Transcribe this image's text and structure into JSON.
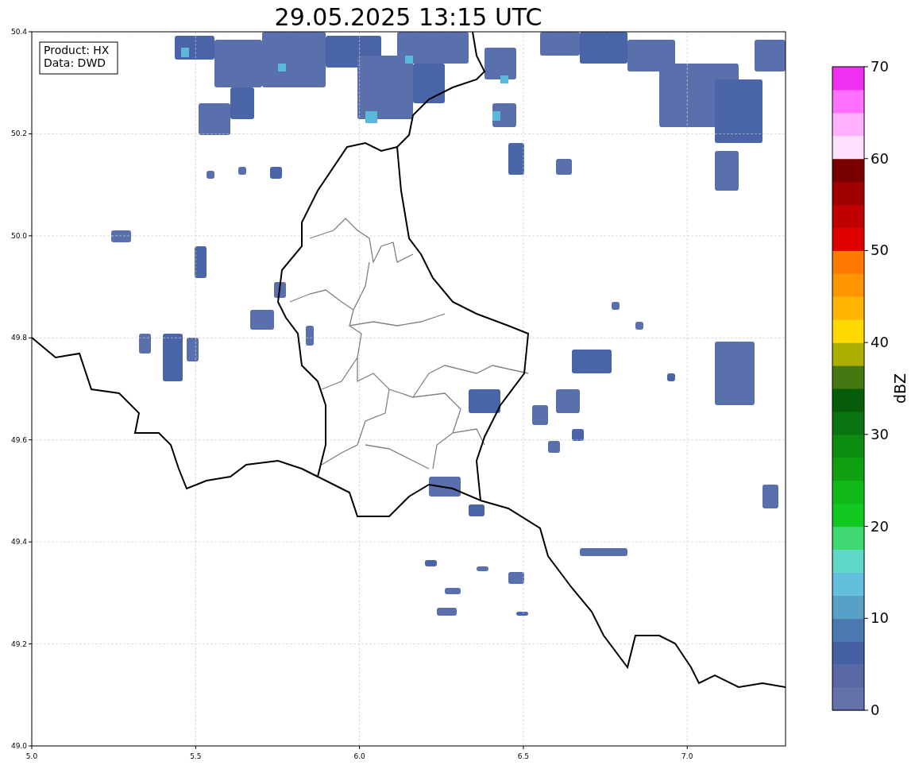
{
  "title": "29.05.2025 13:15 UTC",
  "info_box": [
    "Product: HX",
    "Data: DWD"
  ],
  "map": {
    "xticks": [
      "5.0",
      "5.5",
      "6.0",
      "6.5",
      "7.0"
    ],
    "yticks": [
      "50.4",
      "50.2",
      "50.0",
      "49.8",
      "49.6",
      "49.4",
      "49.2",
      "49.0"
    ]
  },
  "colorbar": {
    "label": "dBZ",
    "ticks": [
      "70",
      "60",
      "50",
      "40",
      "30",
      "20",
      "10",
      "0"
    ],
    "bins": [
      {
        "color": "#6272a8"
      },
      {
        "color": "#5868a4"
      },
      {
        "color": "#4660a4"
      },
      {
        "color": "#4a7ab0"
      },
      {
        "color": "#58a0c8"
      },
      {
        "color": "#62c0dc"
      },
      {
        "color": "#60d8c8"
      },
      {
        "color": "#40d870"
      },
      {
        "color": "#10c820"
      },
      {
        "color": "#10b818"
      },
      {
        "color": "#0ea010"
      },
      {
        "color": "#0c8c10"
      },
      {
        "color": "#0a7410"
      },
      {
        "color": "#065c08"
      },
      {
        "color": "#447810"
      },
      {
        "color": "#acb000"
      },
      {
        "color": "#ffd800"
      },
      {
        "color": "#ffb400"
      },
      {
        "color": "#ff9600"
      },
      {
        "color": "#ff7800"
      },
      {
        "color": "#e00000"
      },
      {
        "color": "#c00000"
      },
      {
        "color": "#a00000"
      },
      {
        "color": "#7a0000"
      },
      {
        "color": "#ffe0ff"
      },
      {
        "color": "#ffb0ff"
      },
      {
        "color": "#ff70ff"
      },
      {
        "color": "#f030f0"
      }
    ]
  }
}
